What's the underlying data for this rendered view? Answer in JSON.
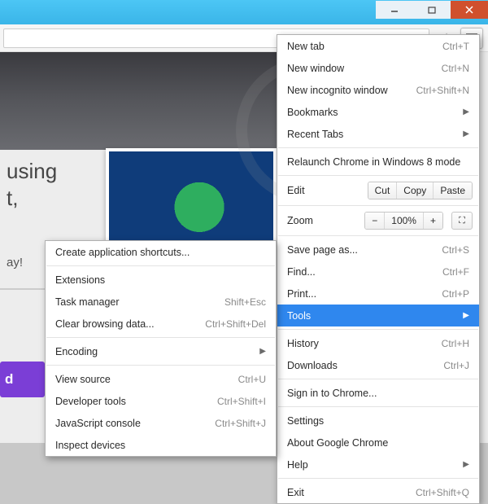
{
  "hero": {
    "line1": "using",
    "line2": "t,",
    "sub": "ay!",
    "purple": "d"
  },
  "mainMenu": {
    "newTab": {
      "label": "New tab",
      "shortcut": "Ctrl+T"
    },
    "newWindow": {
      "label": "New window",
      "shortcut": "Ctrl+N"
    },
    "newIncognito": {
      "label": "New incognito window",
      "shortcut": "Ctrl+Shift+N"
    },
    "bookmarks": {
      "label": "Bookmarks"
    },
    "recentTabs": {
      "label": "Recent Tabs"
    },
    "relaunch": {
      "label": "Relaunch Chrome in Windows 8 mode"
    },
    "edit": {
      "label": "Edit",
      "cut": "Cut",
      "copy": "Copy",
      "paste": "Paste"
    },
    "zoom": {
      "label": "Zoom",
      "minus": "−",
      "value": "100%",
      "plus": "+"
    },
    "saveAs": {
      "label": "Save page as...",
      "shortcut": "Ctrl+S"
    },
    "find": {
      "label": "Find...",
      "shortcut": "Ctrl+F"
    },
    "print": {
      "label": "Print...",
      "shortcut": "Ctrl+P"
    },
    "tools": {
      "label": "Tools"
    },
    "history": {
      "label": "History",
      "shortcut": "Ctrl+H"
    },
    "downloads": {
      "label": "Downloads",
      "shortcut": "Ctrl+J"
    },
    "signIn": {
      "label": "Sign in to Chrome..."
    },
    "settings": {
      "label": "Settings"
    },
    "about": {
      "label": "About Google Chrome"
    },
    "help": {
      "label": "Help"
    },
    "exit": {
      "label": "Exit",
      "shortcut": "Ctrl+Shift+Q"
    }
  },
  "subMenu": {
    "createShortcuts": {
      "label": "Create application shortcuts..."
    },
    "extensions": {
      "label": "Extensions"
    },
    "taskManager": {
      "label": "Task manager",
      "shortcut": "Shift+Esc"
    },
    "clearData": {
      "label": "Clear browsing data...",
      "shortcut": "Ctrl+Shift+Del"
    },
    "encoding": {
      "label": "Encoding"
    },
    "viewSource": {
      "label": "View source",
      "shortcut": "Ctrl+U"
    },
    "devTools": {
      "label": "Developer tools",
      "shortcut": "Ctrl+Shift+I"
    },
    "jsConsole": {
      "label": "JavaScript console",
      "shortcut": "Ctrl+Shift+J"
    },
    "inspect": {
      "label": "Inspect devices"
    }
  }
}
